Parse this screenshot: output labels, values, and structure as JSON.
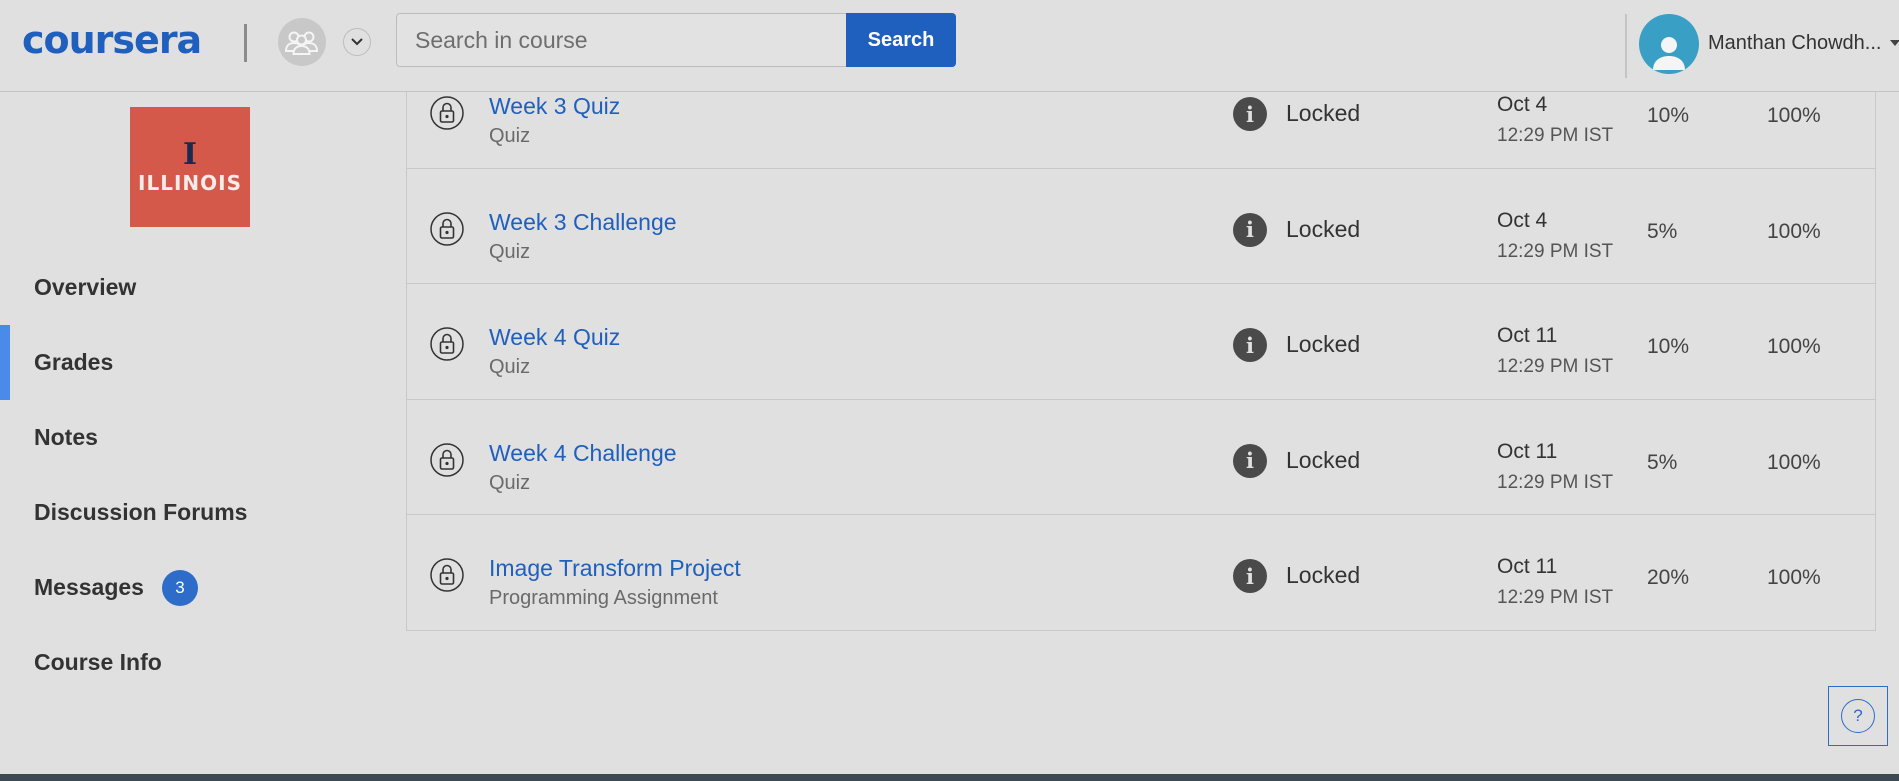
{
  "header": {
    "logo_text": "coursera",
    "search_placeholder": "Search in course",
    "search_button": "Search",
    "user_name": "Manthan Chowdh..."
  },
  "sidebar": {
    "logo_mark": "I",
    "logo_word": "ILLINOIS",
    "items": [
      {
        "label": "Overview",
        "active": false
      },
      {
        "label": "Grades",
        "active": true
      },
      {
        "label": "Notes",
        "active": false
      },
      {
        "label": "Discussion Forums",
        "active": false
      },
      {
        "label": "Messages",
        "active": false,
        "badge": "3"
      },
      {
        "label": "Course Info",
        "active": false
      }
    ]
  },
  "grades": {
    "rows": [
      {
        "title": "Week 3 Quiz",
        "type": "Quiz",
        "status": "Locked",
        "due_date": "Oct 4",
        "due_time": "12:29 PM IST",
        "weight": "10%",
        "grade": "100%"
      },
      {
        "title": "Week 3 Challenge",
        "type": "Quiz",
        "status": "Locked",
        "due_date": "Oct 4",
        "due_time": "12:29 PM IST",
        "weight": "5%",
        "grade": "100%"
      },
      {
        "title": "Week 4 Quiz",
        "type": "Quiz",
        "status": "Locked",
        "due_date": "Oct 11",
        "due_time": "12:29 PM IST",
        "weight": "10%",
        "grade": "100%"
      },
      {
        "title": "Week 4 Challenge",
        "type": "Quiz",
        "status": "Locked",
        "due_date": "Oct 11",
        "due_time": "12:29 PM IST",
        "weight": "5%",
        "grade": "100%"
      },
      {
        "title": "Image Transform Project",
        "type": "Programming Assignment",
        "status": "Locked",
        "due_date": "Oct 11",
        "due_time": "12:29 PM IST",
        "weight": "20%",
        "grade": "100%"
      }
    ]
  },
  "help": {
    "symbol": "?"
  },
  "colors": {
    "brand": "#1f5fbd",
    "active_nav": "#4a8ae8",
    "course_logo": "#d4594a",
    "avatar": "#3a9fc5"
  }
}
